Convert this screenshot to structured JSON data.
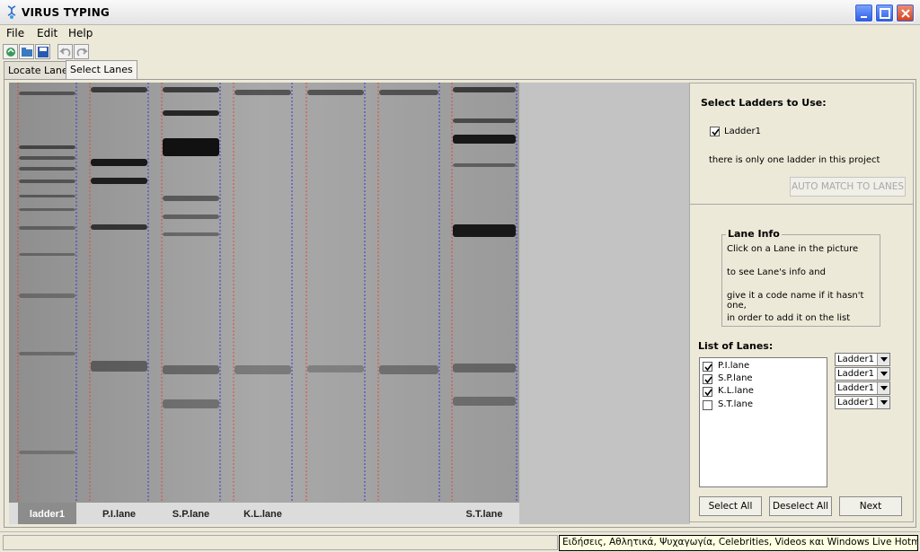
{
  "window": {
    "title": "VIRUS TYPING",
    "icons": {
      "app": "dna-icon",
      "minimize": "minimize-icon",
      "maximize": "maximize-icon",
      "close": "close-icon"
    },
    "accent": "#2a5ae6",
    "close_color": "#d2401b"
  },
  "menu": {
    "file": "File",
    "edit": "Edit",
    "help": "Help"
  },
  "toolbar": {
    "icons": [
      "open-icon",
      "open-folder-icon",
      "save-icon",
      "undo-icon",
      "redo-icon"
    ]
  },
  "tabs": [
    {
      "label": "Locate Lanes",
      "active": false
    },
    {
      "label": "Select Lanes",
      "active": true
    }
  ],
  "gel": {
    "lane_labels": [
      "ladder1",
      "P.I.lane",
      "S.P.lane",
      "K.L.lane",
      "",
      "",
      "S.T.lane"
    ],
    "selected_lane": "ladder1"
  },
  "panel": {
    "ladders_heading": "Select Ladders to Use:",
    "ladder_option": {
      "label": "Ladder1",
      "checked": true
    },
    "ladder_note": "there is only one ladder in this project",
    "auto_match_label": "AUTO MATCH TO LANES",
    "lane_info": {
      "legend": "Lane Info",
      "lines": [
        "Click on a Lane in the picture",
        "to see Lane's info and",
        "give it a code name if it hasn't one,",
        "in order to add it on the list"
      ]
    },
    "lanes_heading": "List of Lanes:",
    "lanes": [
      {
        "label": "P.I.lane",
        "checked": true,
        "ladder": "Ladder1"
      },
      {
        "label": "S.P.lane",
        "checked": true,
        "ladder": "Ladder1"
      },
      {
        "label": "K.L.lane",
        "checked": true,
        "ladder": "Ladder1"
      },
      {
        "label": "S.T.lane",
        "checked": false,
        "ladder": "Ladder1"
      }
    ],
    "buttons": {
      "select_all": "Select All",
      "deselect_all": "Deselect All",
      "next": "Next"
    }
  },
  "statusbar": {
    "tooltip": "Ειδήσεις, Αθλητικά, Ψυχαγωγία, Celebrities, Videos και Windows Live Hotmail.com"
  }
}
